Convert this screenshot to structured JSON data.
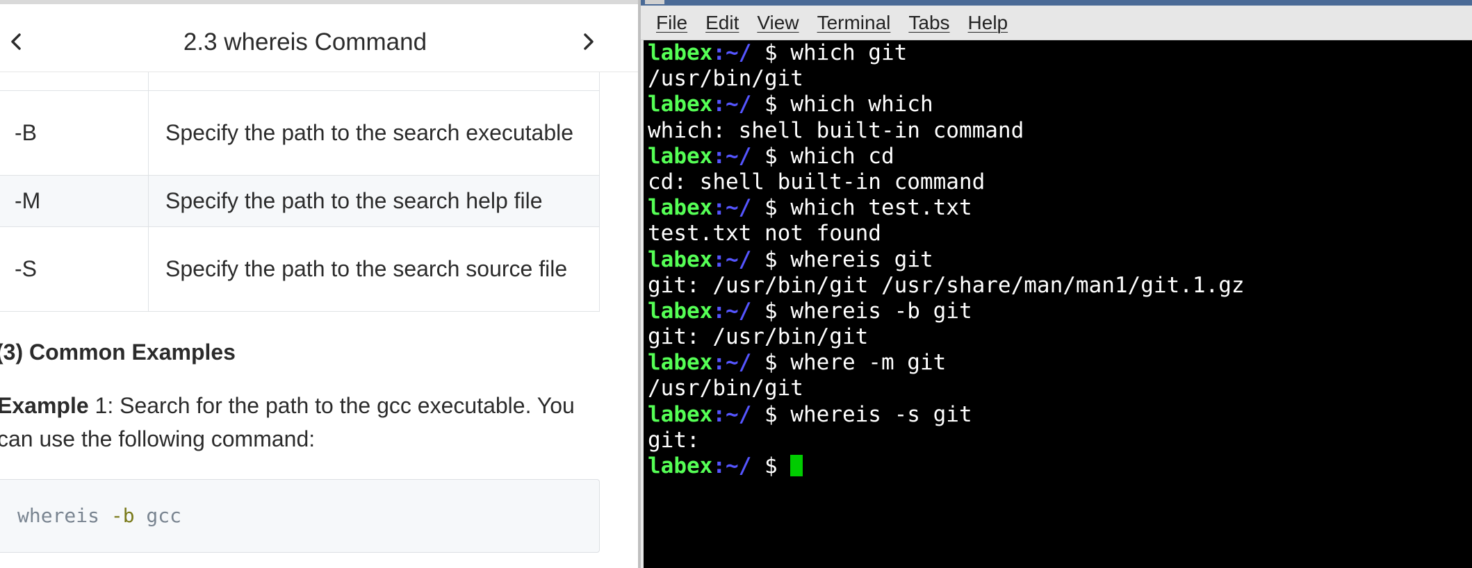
{
  "guide": {
    "title": "2.3 whereis Command",
    "options_table": [
      {
        "key": "-B",
        "desc": "Specify the path to the search executable"
      },
      {
        "key": "-M",
        "desc": "Specify the path to the search help file"
      },
      {
        "key": "-S",
        "desc": "Specify the path to the search source file"
      }
    ],
    "section_heading": "(3) Common Examples",
    "example_label": "Example",
    "example_text": " 1: Search for the path to the gcc executable. You can use the following command:",
    "code": {
      "cmd": "whereis ",
      "flag": "-b",
      "arg": " gcc"
    }
  },
  "terminal": {
    "menu": [
      "File",
      "Edit",
      "View",
      "Terminal",
      "Tabs",
      "Help"
    ],
    "prompt": {
      "user": "labex",
      "path": ":~/",
      "symbol": " $ "
    },
    "lines": [
      {
        "type": "cmd",
        "text": "which git"
      },
      {
        "type": "out",
        "text": "/usr/bin/git"
      },
      {
        "type": "cmd",
        "text": "which which"
      },
      {
        "type": "out",
        "text": "which: shell built-in command"
      },
      {
        "type": "cmd",
        "text": "which cd"
      },
      {
        "type": "out",
        "text": "cd: shell built-in command"
      },
      {
        "type": "cmd",
        "text": "which test.txt"
      },
      {
        "type": "out",
        "text": "test.txt not found"
      },
      {
        "type": "cmd",
        "text": "whereis git"
      },
      {
        "type": "out",
        "text": "git: /usr/bin/git /usr/share/man/man1/git.1.gz"
      },
      {
        "type": "cmd",
        "text": "whereis -b git"
      },
      {
        "type": "out",
        "text": "git: /usr/bin/git"
      },
      {
        "type": "cmd",
        "text": "where -m git"
      },
      {
        "type": "out",
        "text": "/usr/bin/git"
      },
      {
        "type": "cmd",
        "text": "whereis -s git"
      },
      {
        "type": "out",
        "text": "git:"
      },
      {
        "type": "active",
        "text": ""
      }
    ]
  }
}
